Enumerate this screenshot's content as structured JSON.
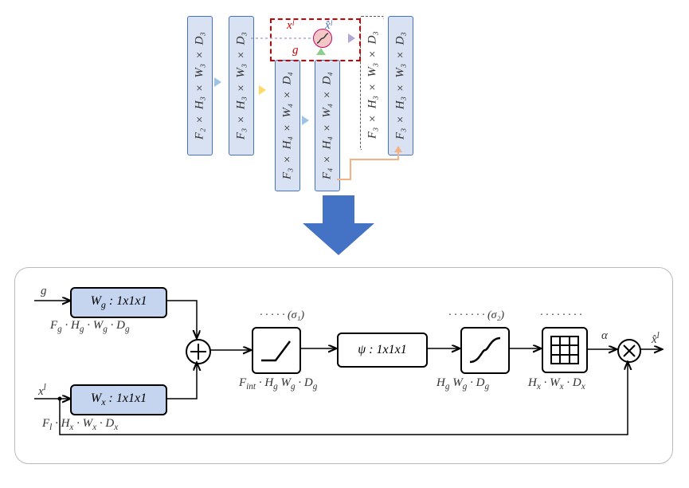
{
  "top": {
    "blocks": [
      "F₂ × H₃ × W₃ × D₃",
      "F₃ × H₃ × W₃ × D₃",
      "F₃ × H₄ × W₄ × D₄",
      "F₄ × H₄ × W₄ × D₄",
      "F₃ × H₃ × W₃ × D₃",
      "F₃ × H₃ × W₃ × D₃"
    ],
    "gate_labels": {
      "xl": "xˡ",
      "g": "g",
      "xhat": "x̂ˡ"
    }
  },
  "bottom": {
    "g_label": "g",
    "xl_label": "xˡ",
    "wg": "W_g : 1x1x1",
    "wx": "W_x : 1x1x1",
    "psi": "ψ : 1x1x1",
    "dims_g": "F_g · H_g · W_g · D_g",
    "dims_x": "F_l · H_x · W_x · D_x",
    "dims_int": "F_int · H_g W_g · D_g",
    "dims_hg": "H_g W_g · D_g",
    "dims_hx": "H_x · W_x · D_x",
    "sigma1": "(σ₁)",
    "sigma2": "(σ₂)",
    "alpha": "α",
    "xhat": "x̂ˡ"
  }
}
